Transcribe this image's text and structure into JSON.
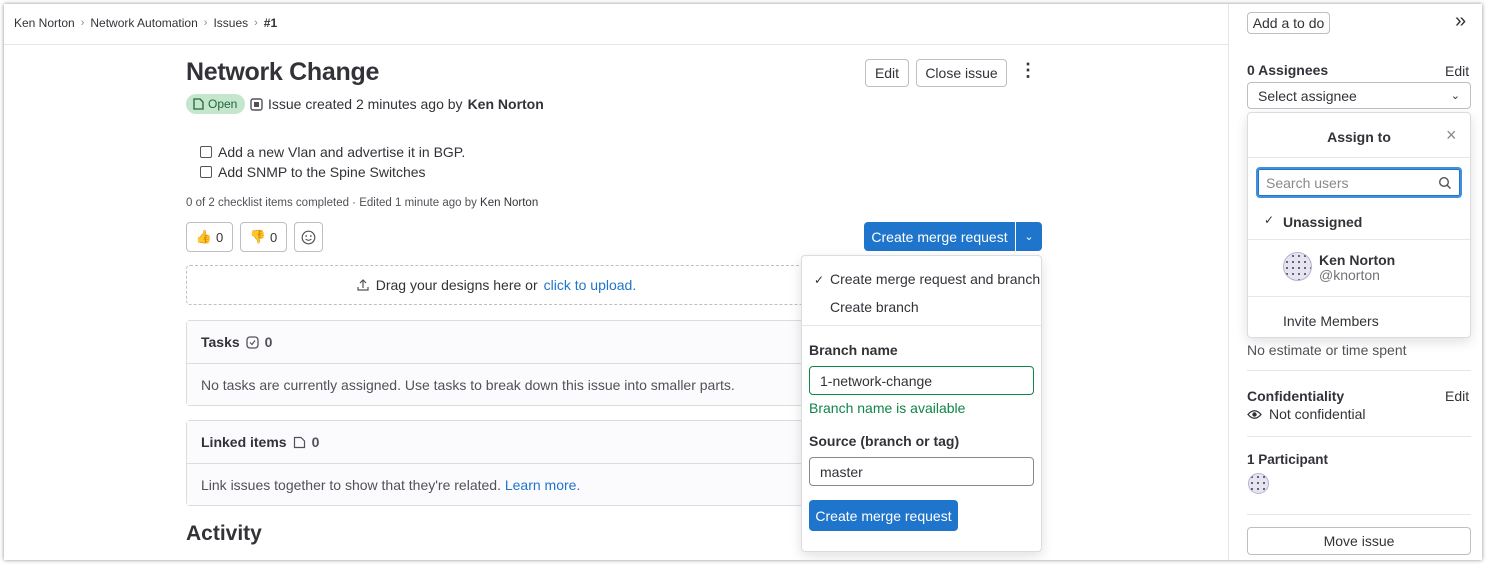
{
  "breadcrumb": [
    "Ken Norton",
    "Network Automation",
    "Issues",
    "#1"
  ],
  "issue": {
    "title": "Network Change",
    "status": "Open",
    "created_text": "Issue created 2 minutes ago by",
    "author": "Ken Norton",
    "checklist": [
      "Add a new Vlan and advertise it in BGP.",
      "Add SNMP to the Spine Switches"
    ],
    "edited_text": "0 of 2 checklist items completed · Edited 1 minute ago by",
    "edited_by": "Ken Norton"
  },
  "header_actions": {
    "edit": "Edit",
    "close": "Close issue",
    "more": "⋮"
  },
  "reactions": {
    "thumbs_up": "0",
    "thumbs_down": "0"
  },
  "create_mr": {
    "label": "Create merge request"
  },
  "dropzone": {
    "text": "Drag your designs here or",
    "link": "click to upload."
  },
  "tasks": {
    "title": "Tasks",
    "count": "0",
    "body": "No tasks are currently assigned. Use tasks to break down this issue into smaller parts."
  },
  "linked": {
    "title": "Linked items",
    "count": "0",
    "body": "Link issues together to show that they're related.",
    "link": "Learn more."
  },
  "activity": "Activity",
  "mr_dropdown": {
    "option_selected": "Create merge request and branch",
    "option_2": "Create branch",
    "branch_label": "Branch name",
    "branch_value": "1-network-change",
    "branch_status": "Branch name is available",
    "source_label": "Source (branch or tag)",
    "source_value": "master",
    "submit": "Create merge request"
  },
  "sidebar": {
    "todo": "Add a to do",
    "collapse": "»",
    "assignees_title": "0 Assignees",
    "assignees_edit": "Edit",
    "select_assignee": "Select assignee",
    "assign_pop": {
      "title": "Assign to",
      "close": "×",
      "search_placeholder": "Search users",
      "unassigned": "Unassigned",
      "user_name": "Ken Norton",
      "user_handle": "@knorton",
      "invite": "Invite Members"
    },
    "time_tracking": "No estimate or time spent",
    "confidentiality_title": "Confidentiality",
    "confidentiality_edit": "Edit",
    "confidentiality_value": "Not confidential",
    "participants_title": "1 Participant",
    "move_issue": "Move issue"
  },
  "colors": {
    "primary": "#1f75cb",
    "open_badge_bg": "#c3e6cd",
    "open_badge_text": "#24663b",
    "success_text": "#108548"
  }
}
